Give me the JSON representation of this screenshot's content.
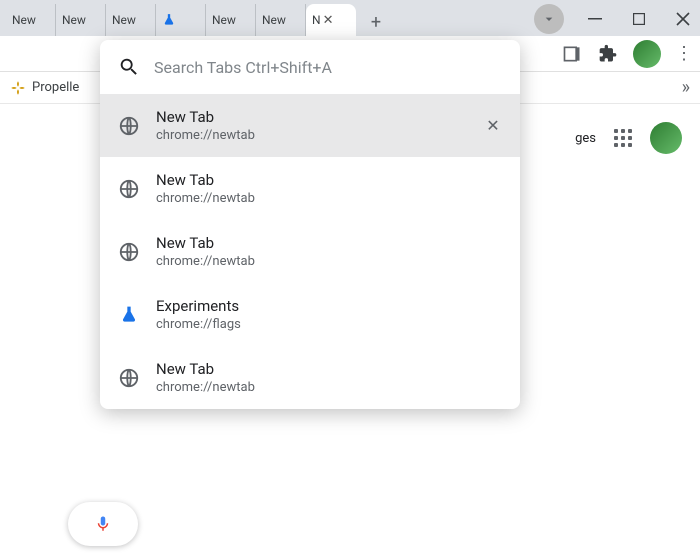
{
  "tabs": [
    {
      "label": "New"
    },
    {
      "label": "New"
    },
    {
      "label": "New"
    },
    {
      "label": "",
      "icon": "flask"
    },
    {
      "label": "New"
    },
    {
      "label": "New"
    },
    {
      "label": "N",
      "active": true
    }
  ],
  "toolbar": {
    "new_tab_plus": "+"
  },
  "bookmarks": {
    "item1": "Propelle"
  },
  "ntp": {
    "images_link": "ges"
  },
  "tab_search": {
    "placeholder": "Search Tabs Ctrl+Shift+A",
    "items": [
      {
        "title": "New Tab",
        "url": "chrome://newtab",
        "icon": "globe",
        "highlight": true,
        "closable": true
      },
      {
        "title": "New Tab",
        "url": "chrome://newtab",
        "icon": "globe"
      },
      {
        "title": "New Tab",
        "url": "chrome://newtab",
        "icon": "globe"
      },
      {
        "title": "Experiments",
        "url": "chrome://flags",
        "icon": "flask"
      },
      {
        "title": "New Tab",
        "url": "chrome://newtab",
        "icon": "globe"
      }
    ]
  }
}
